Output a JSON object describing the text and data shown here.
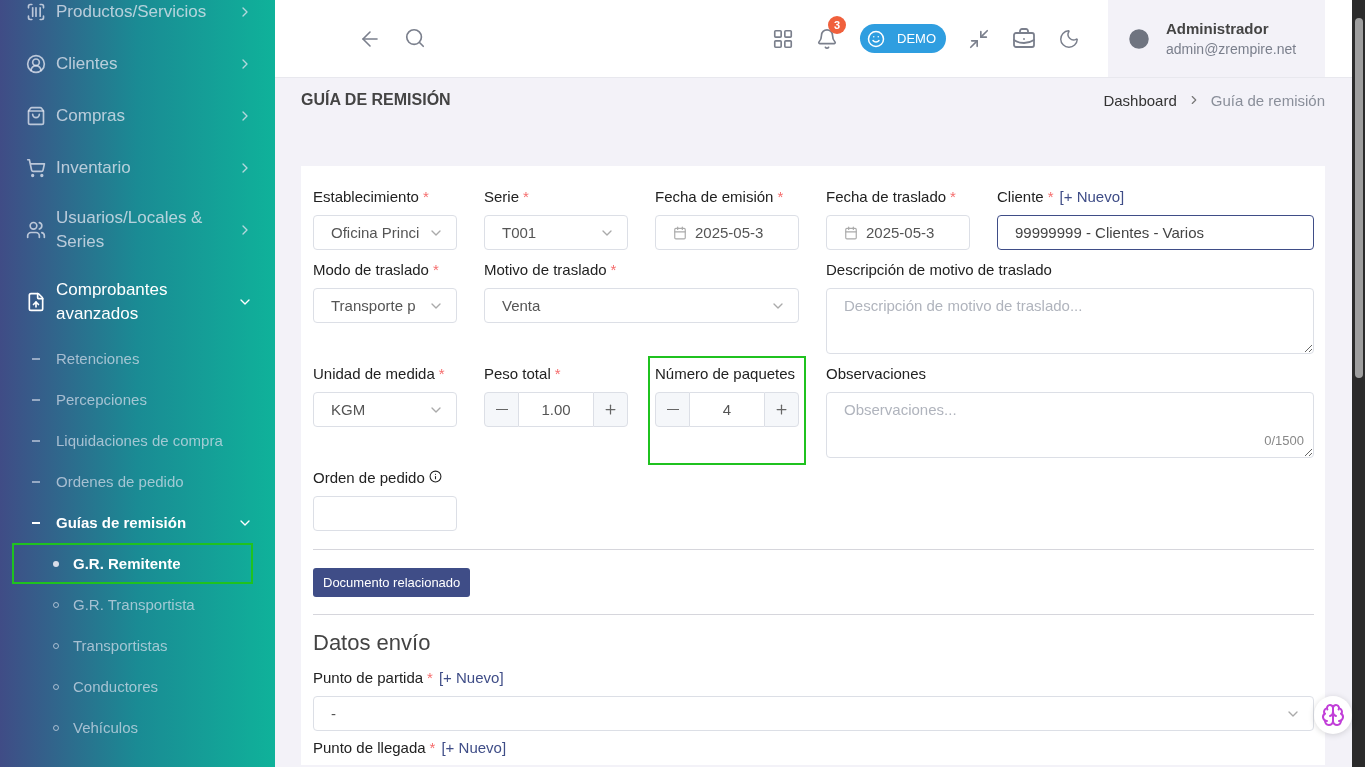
{
  "sidebar": {
    "items": [
      {
        "label": "Productos/Servicios",
        "expanded": false
      },
      {
        "label": "Clientes",
        "expanded": false
      },
      {
        "label": "Compras",
        "expanded": false
      },
      {
        "label": "Inventario",
        "expanded": false
      },
      {
        "label": "Usuarios/Locales & Series",
        "expanded": false
      },
      {
        "label": "Comprobantes avanzados",
        "expanded": true,
        "children": [
          {
            "label": "Retenciones",
            "expanded": false
          },
          {
            "label": "Percepciones",
            "expanded": false
          },
          {
            "label": "Liquidaciones de compra",
            "expanded": false
          },
          {
            "label": "Ordenes de pedido",
            "expanded": false
          },
          {
            "label": "Guías de remisión",
            "expanded": true,
            "children": [
              {
                "label": "G.R. Remitente",
                "selected": true,
                "highlighted": true
              },
              {
                "label": "G.R. Transportista",
                "selected": false,
                "highlighted": false
              },
              {
                "label": "Transportistas",
                "selected": false,
                "highlighted": false
              },
              {
                "label": "Conductores",
                "selected": false,
                "highlighted": false
              },
              {
                "label": "Vehículos",
                "selected": false,
                "highlighted": false
              }
            ]
          }
        ]
      }
    ]
  },
  "header": {
    "notification_count": "3",
    "demo_label": "DEMO",
    "user": {
      "name": "Administrador",
      "email": "admin@zrempire.net"
    }
  },
  "page": {
    "title": "GUÍA DE REMISIÓN",
    "breadcrumb": [
      {
        "label": "Dashboard",
        "current": false
      },
      {
        "label": "Guía de remisión",
        "current": true
      }
    ]
  },
  "form": {
    "rows": [
      [
        {
          "kind": "select",
          "label": "Establecimiento",
          "required_mark": "*",
          "value": "Oficina Princi",
          "highlighted": false
        },
        {
          "kind": "select",
          "label": "Serie",
          "required_mark": "*",
          "value": "T001",
          "highlighted": false
        },
        {
          "kind": "date",
          "label": "Fecha de emisión",
          "required_mark": "*",
          "value": "2025-05-3",
          "highlighted": false
        },
        {
          "kind": "date",
          "label": "Fecha de traslado",
          "required_mark": "*",
          "value": "2025-05-3",
          "highlighted": false
        },
        {
          "kind": "text",
          "label": "Cliente",
          "required_mark": "*",
          "link": "[+ Nuevo]",
          "value": "99999999 - Clientes - Varios",
          "focused": true,
          "highlighted": false
        }
      ],
      [
        {
          "kind": "select",
          "label": "Modo de traslado",
          "required_mark": "*",
          "value": "Transporte p",
          "highlighted": false
        },
        {
          "kind": "select",
          "label": "Motivo de traslado",
          "required_mark": "*",
          "value": "Venta",
          "highlighted": false
        },
        "",
        {
          "kind": "textarea",
          "label": "Descripción de motivo de traslado",
          "placeholder": "Descripción de motivo de traslado...",
          "highlighted": false
        },
        ""
      ],
      [
        {
          "kind": "select",
          "label": "Unidad de medida",
          "required_mark": "*",
          "value": "KGM",
          "highlighted": false
        },
        {
          "kind": "stepper",
          "label": "Peso total",
          "required_mark": "*",
          "value": "1.00",
          "highlighted": false
        },
        {
          "kind": "stepper",
          "label": "Número de paquetes",
          "value": "4",
          "highlighted": true
        },
        {
          "kind": "textarea",
          "label": "Observaciones",
          "placeholder": "Observaciones...",
          "counter": "0/1500",
          "highlighted": false
        },
        ""
      ],
      [
        {
          "kind": "text",
          "label": "Orden de pedido",
          "info": true,
          "focused": false,
          "highlighted": false
        }
      ]
    ],
    "related_button": "Documento relacionado"
  },
  "shipping": {
    "title": "Datos envío",
    "fields": [
      {
        "label": "Punto de partida",
        "required_mark": "*",
        "link": "[+ Nuevo]",
        "value": "-"
      },
      {
        "label": "Punto de llegada",
        "required_mark": "*",
        "link": "[+ Nuevo]"
      }
    ]
  }
}
